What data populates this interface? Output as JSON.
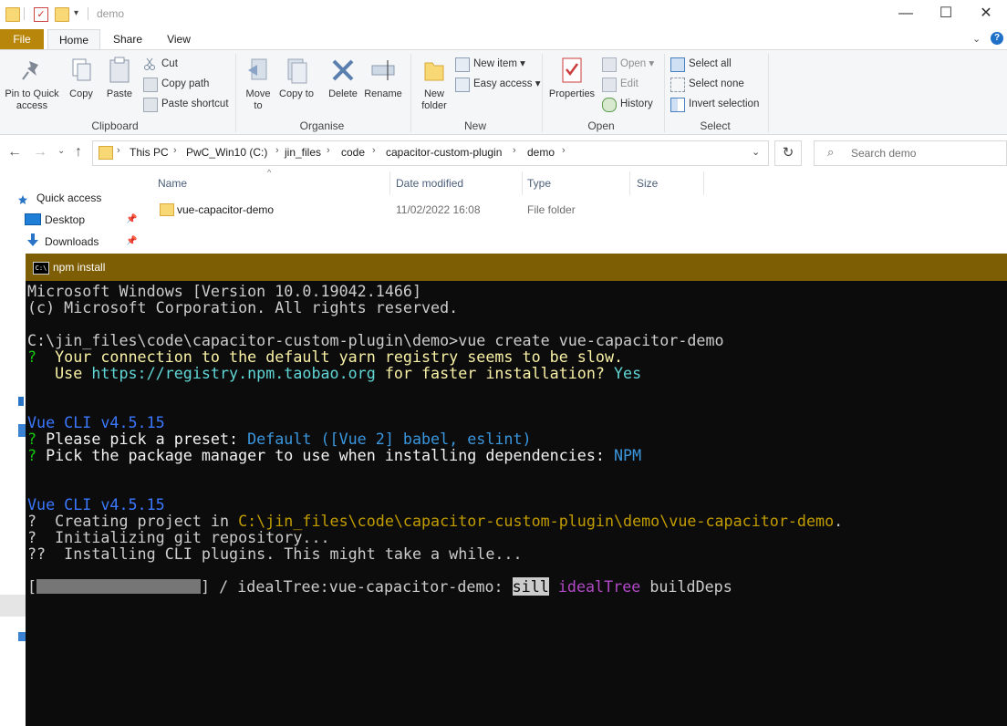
{
  "window": {
    "title": "demo"
  },
  "ribbon_tabs": [
    "File",
    "Home",
    "Share",
    "View"
  ],
  "ribbon": {
    "clipboard": {
      "label": "Clipboard",
      "pin": "Pin to Quick access",
      "copy": "Copy",
      "paste": "Paste",
      "cut": "Cut",
      "copy_path": "Copy path",
      "paste_shortcut": "Paste shortcut"
    },
    "organise": {
      "label": "Organise",
      "move_to": "Move to",
      "copy_to": "Copy to",
      "delete": "Delete",
      "rename": "Rename"
    },
    "new": {
      "label": "New",
      "new_folder": "New folder",
      "new_item": "New item",
      "easy_access": "Easy access"
    },
    "open": {
      "label": "Open",
      "properties": "Properties",
      "open": "Open",
      "edit": "Edit",
      "history": "History"
    },
    "select": {
      "label": "Select",
      "select_all": "Select all",
      "select_none": "Select none",
      "invert": "Invert selection"
    }
  },
  "address": {
    "breadcrumbs": [
      "This PC",
      "PwC_Win10 (C:)",
      "jin_files",
      "code",
      "capacitor-custom-plugin",
      "demo"
    ],
    "search_placeholder": "Search demo"
  },
  "nav_pane": [
    "Quick access",
    "Desktop",
    "Downloads"
  ],
  "file_list": {
    "columns": [
      "Name",
      "Date modified",
      "Type",
      "Size"
    ],
    "rows": [
      {
        "name": "vue-capacitor-demo",
        "date": "11/02/2022 16:08",
        "type": "File folder",
        "size": ""
      }
    ]
  },
  "console": {
    "title": "npm install",
    "lines": {
      "l1": "Microsoft Windows [Version 10.0.19042.1466]",
      "l2": "(c) Microsoft Corporation. All rights reserved.",
      "l3": "C:\\jin_files\\code\\capacitor-custom-plugin\\demo>vue create vue-capacitor-demo",
      "l4q": "?",
      "l4": "  Your connection to the default yarn registry seems to be slow.",
      "l5a": "   Use ",
      "l5b": "https://registry.npm.taobao.org",
      "l5c": " for faster installation? ",
      "l5d": "Yes",
      "l6": "Vue CLI v4.5.15",
      "l7q": "?",
      "l7a": " Please pick a preset: ",
      "l7b": "Default ([Vue 2] babel, eslint)",
      "l8q": "?",
      "l8a": " Pick the package manager to use when installing dependencies: ",
      "l8b": "NPM",
      "l9": "Vue CLI v4.5.15",
      "l10a": "?  Creating project in ",
      "l10b": "C:\\jin_files\\code\\capacitor-custom-plugin\\demo\\vue-capacitor-demo",
      "l10c": ".",
      "l11": "?  Initializing git repository...",
      "l12": "??  Installing CLI plugins. This might take a while...",
      "l13a": "[",
      "l13b": "] / idealTree:vue-capacitor-demo: ",
      "l13c": "sill",
      "l13d": " idealTree",
      "l13e": " buildDeps"
    }
  }
}
